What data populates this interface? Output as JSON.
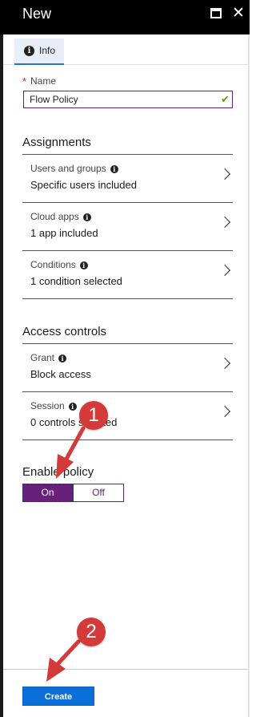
{
  "window": {
    "title": "New",
    "maximize_icon": "maximize-icon",
    "close_glyph": "✕"
  },
  "tabs": [
    {
      "label": "Info",
      "icon": "info-icon",
      "active": true
    }
  ],
  "name_field": {
    "label": "Name",
    "required_mark": "*",
    "value": "Flow Policy",
    "valid_icon": "✔"
  },
  "assignments": {
    "title": "Assignments",
    "rows": [
      {
        "label": "Users and groups",
        "value": "Specific users included"
      },
      {
        "label": "Cloud apps",
        "value": "1 app included"
      },
      {
        "label": "Conditions",
        "value": "1 condition selected"
      }
    ]
  },
  "access_controls": {
    "title": "Access controls",
    "rows": [
      {
        "label": "Grant",
        "value": "Block access"
      },
      {
        "label": "Session",
        "value": "0 controls selected"
      }
    ]
  },
  "enable_policy": {
    "label": "Enable policy",
    "on_label": "On",
    "off_label": "Off",
    "selected": "On"
  },
  "footer": {
    "create_label": "Create"
  },
  "annotations": {
    "callout_1": "1",
    "callout_2": "2",
    "color": "#d43a3a"
  },
  "colors": {
    "accent_purple": "#68217a",
    "primary_blue": "#0a6fd9",
    "success_green": "#57a300"
  }
}
